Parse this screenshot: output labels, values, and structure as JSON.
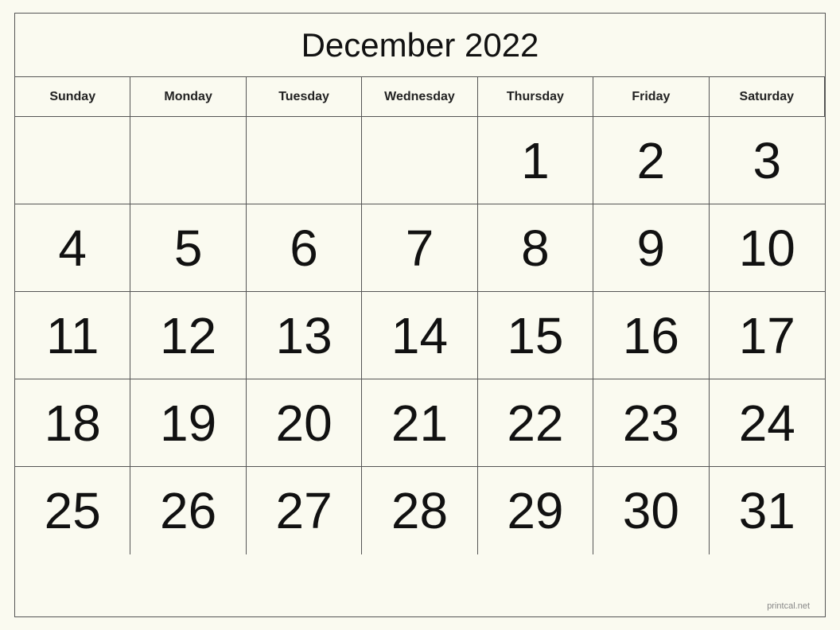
{
  "calendar": {
    "title": "December 2022",
    "days_of_week": [
      "Sunday",
      "Monday",
      "Tuesday",
      "Wednesday",
      "Thursday",
      "Friday",
      "Saturday"
    ],
    "weeks": [
      [
        "",
        "",
        "",
        "",
        "1",
        "2",
        "3"
      ],
      [
        "4",
        "5",
        "6",
        "7",
        "8",
        "9",
        "10"
      ],
      [
        "11",
        "12",
        "13",
        "14",
        "15",
        "16",
        "17"
      ],
      [
        "18",
        "19",
        "20",
        "21",
        "22",
        "23",
        "24"
      ],
      [
        "25",
        "26",
        "27",
        "28",
        "29",
        "30",
        "31"
      ]
    ]
  },
  "watermark": "printcal.net"
}
